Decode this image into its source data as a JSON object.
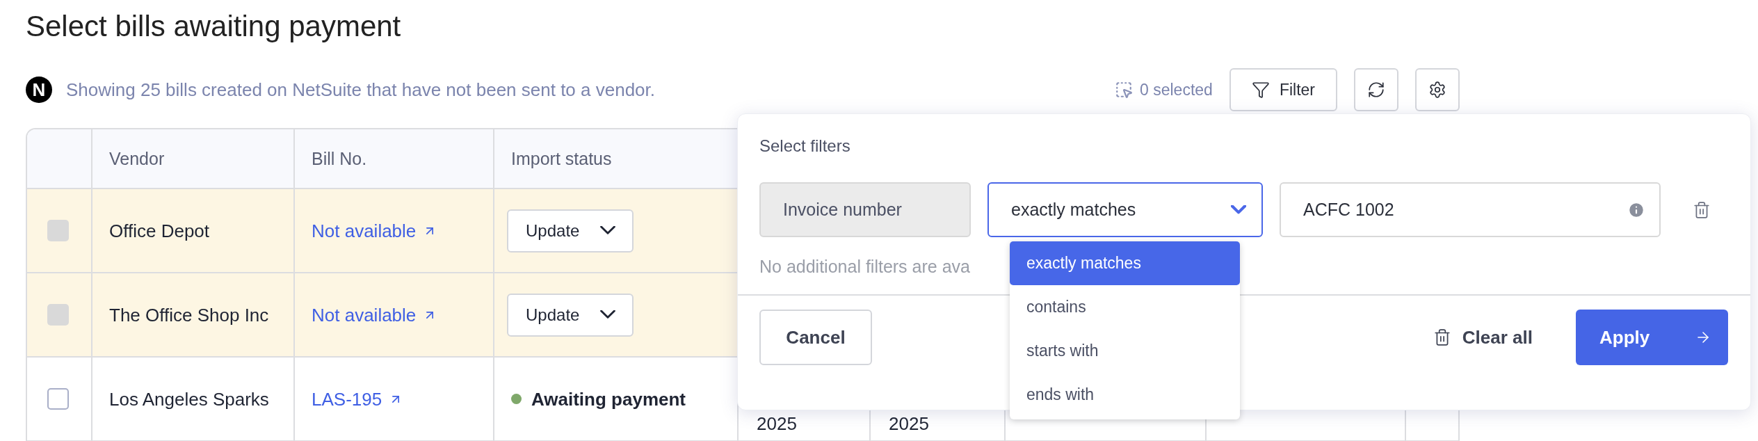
{
  "title": "Select bills awaiting payment",
  "source": {
    "logo_letter": "N",
    "text": "Showing 25 bills created on NetSuite that have not been sent to a vendor."
  },
  "toolbar": {
    "selected_count": "0 selected",
    "filter_label": "Filter"
  },
  "table": {
    "columns": [
      "",
      "Vendor",
      "Bill No.",
      "Import status"
    ],
    "rows": [
      {
        "highlighted": true,
        "checkbox": {
          "checked": false,
          "disabled": true
        },
        "vendor": "Office Depot",
        "bill_no": "Not available",
        "import_status": {
          "kind": "dropdown",
          "label": "Update"
        },
        "column_5": "",
        "column_6": ""
      },
      {
        "highlighted": true,
        "checkbox": {
          "checked": false,
          "disabled": true
        },
        "vendor": "The Office Shop Inc",
        "bill_no": "Not available",
        "import_status": {
          "kind": "dropdown",
          "label": "Update"
        },
        "column_5": "",
        "column_6": ""
      },
      {
        "highlighted": false,
        "checkbox": {
          "checked": false,
          "disabled": false
        },
        "vendor": "Los Angeles Sparks",
        "bill_no": "LAS-195",
        "import_status": {
          "kind": "status",
          "label": "Awaiting payment",
          "color": "#7fa86a"
        },
        "column_5": "2025",
        "column_6": "2025"
      }
    ]
  },
  "filter_panel": {
    "title": "Select filters",
    "filter": {
      "field": "Invoice number",
      "operator": "exactly matches",
      "value": "ACFC 1002"
    },
    "note": "No additional filters are ava",
    "operator_options": [
      {
        "label": "exactly matches",
        "selected": true
      },
      {
        "label": "contains",
        "selected": false
      },
      {
        "label": "starts with",
        "selected": false
      },
      {
        "label": "ends with",
        "selected": false
      }
    ],
    "buttons": {
      "cancel": "Cancel",
      "clear": "Clear all",
      "apply": "Apply"
    }
  }
}
